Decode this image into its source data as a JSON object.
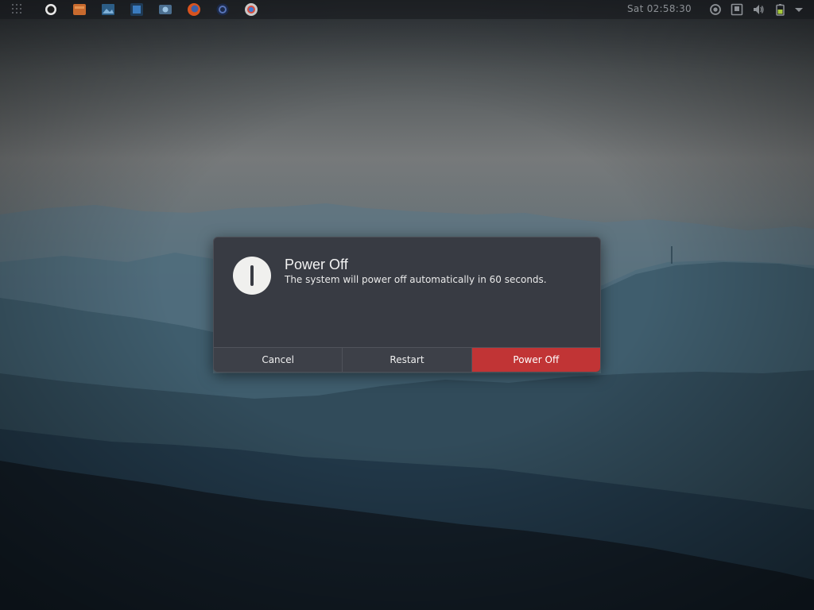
{
  "top_panel": {
    "clock": "Sat 02:58:30",
    "launcher_icons": [
      "apps-grid-icon",
      "app-icon-1",
      "files-icon",
      "image-viewer-icon",
      "app-icon-4",
      "photos-icon",
      "firefox-icon",
      "app-icon-7",
      "chrome-icon"
    ],
    "tray_icons": [
      "record-icon",
      "network-icon",
      "volume-icon",
      "battery-icon",
      "chevron-down-icon"
    ]
  },
  "dialog": {
    "title": "Power Off",
    "message": "The system will power off automatically in 60 seconds.",
    "buttons": {
      "cancel": "Cancel",
      "restart": "Restart",
      "power_off": "Power Off"
    }
  },
  "colors": {
    "dialog_background": "#383b43",
    "power_off_accent": "#c13435",
    "panel_text": "#8c9095"
  }
}
